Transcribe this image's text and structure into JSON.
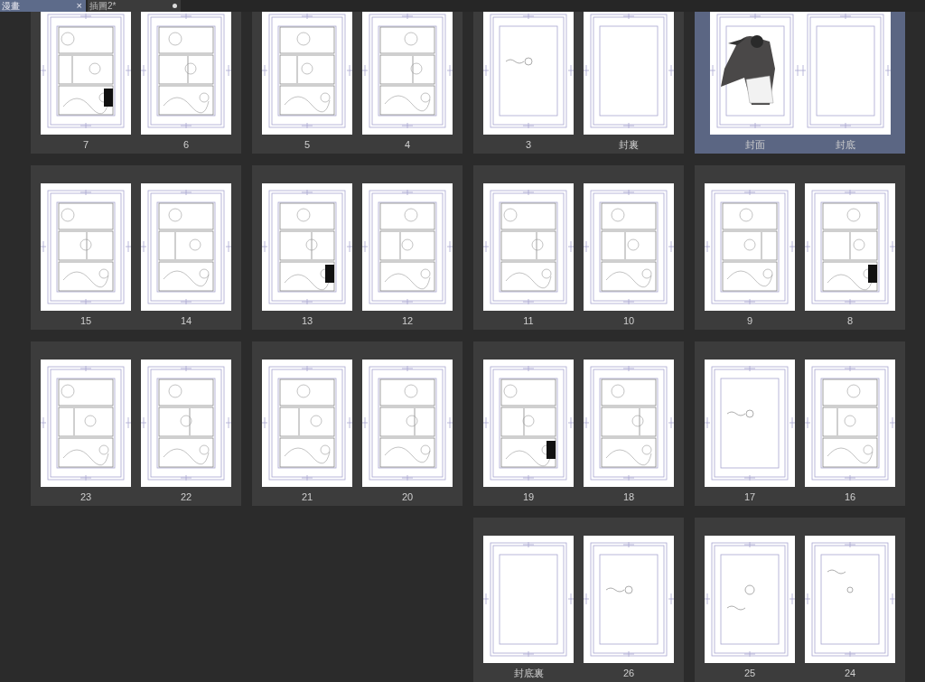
{
  "tabs": [
    {
      "label": "漫畫",
      "selected": true,
      "close": "×"
    },
    {
      "label": "插圖2*",
      "selected": false,
      "modified": true
    }
  ],
  "rows": [
    {
      "spreads": [
        {
          "selected": false,
          "kind": "pair",
          "pages": [
            {
              "label": "7",
              "kind": "comic"
            },
            {
              "label": "6",
              "kind": "comic"
            }
          ]
        },
        {
          "selected": false,
          "kind": "pair",
          "pages": [
            {
              "label": "5",
              "kind": "comic"
            },
            {
              "label": "4",
              "kind": "comic"
            }
          ]
        },
        {
          "selected": false,
          "kind": "pair",
          "pages": [
            {
              "label": "3",
              "kind": "note"
            },
            {
              "label": "封裏",
              "kind": "blank"
            }
          ]
        },
        {
          "selected": true,
          "kind": "joined",
          "pages": [
            {
              "label": "封面",
              "kind": "cover"
            },
            {
              "label": "封底",
              "kind": "blank"
            }
          ]
        }
      ]
    },
    {
      "spreads": [
        {
          "selected": false,
          "kind": "pair",
          "pages": [
            {
              "label": "15",
              "kind": "comic"
            },
            {
              "label": "14",
              "kind": "comic"
            }
          ]
        },
        {
          "selected": false,
          "kind": "pair",
          "pages": [
            {
              "label": "13",
              "kind": "comic"
            },
            {
              "label": "12",
              "kind": "comic"
            }
          ]
        },
        {
          "selected": false,
          "kind": "pair",
          "pages": [
            {
              "label": "11",
              "kind": "comic"
            },
            {
              "label": "10",
              "kind": "comic"
            }
          ]
        },
        {
          "selected": false,
          "kind": "pair",
          "pages": [
            {
              "label": "9",
              "kind": "comic"
            },
            {
              "label": "8",
              "kind": "comic"
            }
          ]
        }
      ]
    },
    {
      "spreads": [
        {
          "selected": false,
          "kind": "pair",
          "pages": [
            {
              "label": "23",
              "kind": "comic"
            },
            {
              "label": "22",
              "kind": "comic"
            }
          ]
        },
        {
          "selected": false,
          "kind": "pair",
          "pages": [
            {
              "label": "21",
              "kind": "comic"
            },
            {
              "label": "20",
              "kind": "comic"
            }
          ]
        },
        {
          "selected": false,
          "kind": "pair",
          "pages": [
            {
              "label": "19",
              "kind": "comic"
            },
            {
              "label": "18",
              "kind": "comic"
            }
          ]
        },
        {
          "selected": false,
          "kind": "pair",
          "pages": [
            {
              "label": "17",
              "kind": "note"
            },
            {
              "label": "16",
              "kind": "comic"
            }
          ]
        }
      ]
    },
    {
      "spreads": [
        {
          "selected": false,
          "kind": "pair",
          "pages": [
            {
              "label": "封底裏",
              "kind": "blank"
            },
            {
              "label": "26",
              "kind": "note"
            }
          ]
        },
        {
          "selected": false,
          "kind": "pair",
          "pages": [
            {
              "label": "25",
              "kind": "note"
            },
            {
              "label": "24",
              "kind": "note"
            }
          ]
        }
      ]
    }
  ]
}
